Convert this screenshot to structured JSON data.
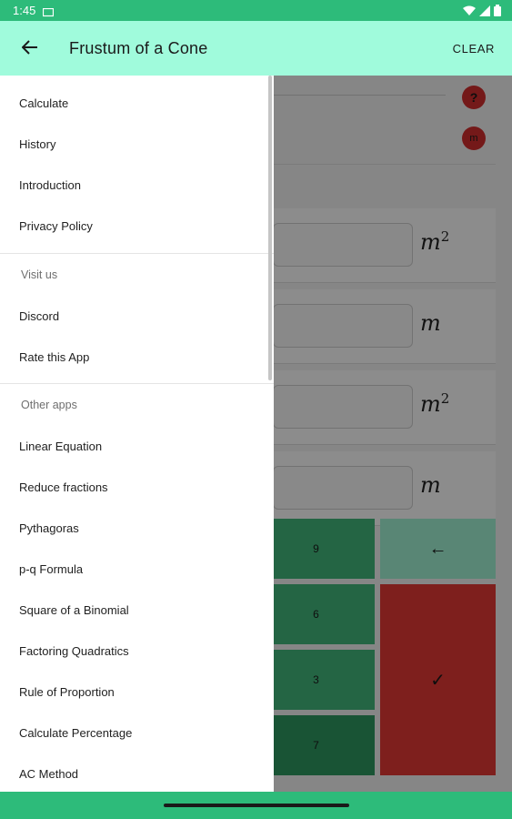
{
  "status_bar": {
    "time": "1:45"
  },
  "app_bar": {
    "title": "Frustum of a Cone",
    "clear_label": "CLEAR"
  },
  "background": {
    "help_label": "?",
    "unit_label": "m",
    "fields": [
      {
        "unit": "m",
        "exponent": "2"
      },
      {
        "unit": "m",
        "exponent": ""
      },
      {
        "unit": "m",
        "exponent": "2"
      },
      {
        "unit": "m",
        "exponent": ""
      }
    ],
    "keys": {
      "nine": "9",
      "six": "6",
      "three": "3",
      "seven": "7",
      "back": "←",
      "ok": "✓"
    }
  },
  "drawer": {
    "main_items": [
      "Calculate",
      "History",
      "Introduction",
      "Privacy Policy"
    ],
    "visit_header": "Visit us",
    "visit_items": [
      "Discord",
      "Rate this App"
    ],
    "other_header": "Other apps",
    "other_items": [
      "Linear Equation",
      "Reduce fractions",
      "Pythagoras",
      "p-q Formula",
      "Square of a Binomial",
      "Factoring Quadratics",
      "Rule of Proportion",
      "Calculate Percentage",
      "AC Method"
    ]
  },
  "colors": {
    "status_bar": "#2dbb7a",
    "app_bar": "#a0fbdc",
    "keypad_green": "#43b97d",
    "confirm_red": "#e53935"
  }
}
